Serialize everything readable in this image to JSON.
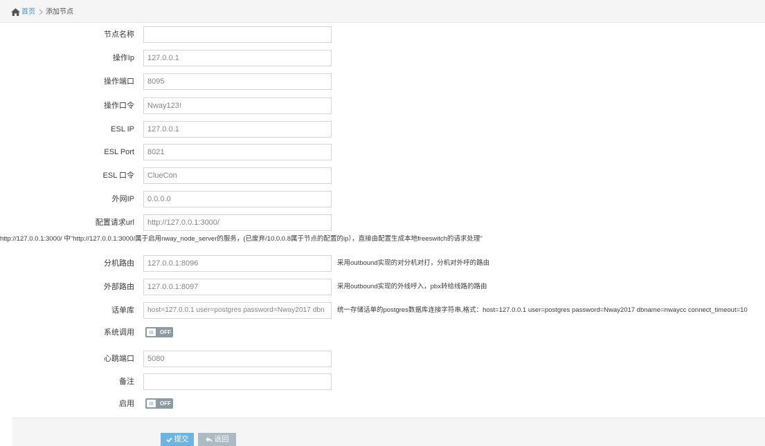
{
  "breadcrumb": {
    "home_label": "首页",
    "current": "添加节点"
  },
  "form": {
    "node_name": {
      "label": "节点名称",
      "value": ""
    },
    "op_ip": {
      "label": "操作Ip",
      "value": "127.0.0.1"
    },
    "op_port": {
      "label": "操作端口",
      "value": "8095"
    },
    "op_password": {
      "label": "操作口令",
      "value": "Nway123!"
    },
    "esl_ip": {
      "label": "ESL IP",
      "value": "127.0.0.1"
    },
    "esl_port": {
      "label": "ESL Port",
      "value": "8021"
    },
    "esl_password": {
      "label": "ESL 口令",
      "value": "ClueCon"
    },
    "public_ip": {
      "label": "外网IP",
      "value": "0.0.0.0"
    },
    "config_url": {
      "label": "配置请求url",
      "value": "http://127.0.0.1:3000/",
      "help": "http://127.0.0.1:3000/ 中\"http://127.0.0.1:3000/属于启用nway_node_server的服务，(已废弃/10.0.0.8属于节点的配置的ip），直接由配置生成本地freeswitch的请求处理\""
    },
    "ext_route": {
      "label": "分机路由",
      "value": "127.0.0.1:8096",
      "help": "采用outbound实现的对分机对打，分机对外呼的路由"
    },
    "out_route": {
      "label": "外部路由",
      "value": "127.0.0.1:8097",
      "help": "采用outbound实现的外线呼入，pbx转给线路的路由"
    },
    "cdr_db": {
      "label": "话单库",
      "value": "host=127.0.0.1 user=postgres password=Nway2017 dbn",
      "help": "统一存储话单的postgres数据库连接字符串,格式：host=127.0.0.1 user=postgres password=Nway2017 dbname=nwaycc connect_timeout=10"
    },
    "system_call": {
      "label": "系统调用",
      "state": "OFF"
    },
    "heartbeat_port": {
      "label": "心跳端口",
      "value": "5080"
    },
    "remark": {
      "label": "备注",
      "value": ""
    },
    "enabled": {
      "label": "启用",
      "state": "OFF"
    }
  },
  "actions": {
    "submit_label": "提交",
    "back_label": "返回"
  },
  "icons": {
    "home": "home-icon",
    "separator": "chevron-right-icon",
    "switch_knob": "grip-icon",
    "submit": "check-icon",
    "back": "reply-icon"
  },
  "colors": {
    "link": "#4c8fbd",
    "submit_button": "#6fb3e0",
    "back_button": "#abbac3",
    "switch_off": "#8b9aa3",
    "input_border": "#d5d5d5",
    "bar_background": "#f5f5f5"
  }
}
